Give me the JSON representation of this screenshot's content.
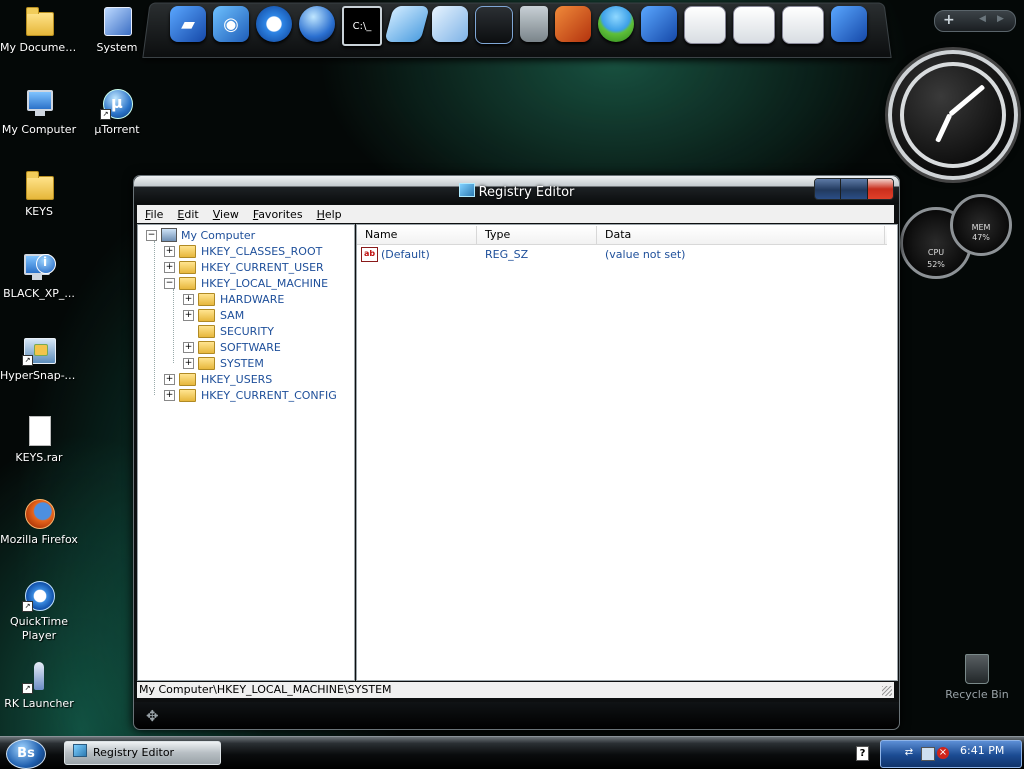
{
  "desktop": {
    "icons": [
      {
        "label": "My Documents"
      },
      {
        "label": "System"
      },
      {
        "label": "My Computer"
      },
      {
        "label": "µTorrent"
      },
      {
        "label": "KEYS"
      },
      {
        "label": "BLACK_XP_..."
      },
      {
        "label": "HyperSnap-v..."
      },
      {
        "label": "KEYS.rar"
      },
      {
        "label": "Mozilla Firefox"
      },
      {
        "label": "QuickTime Player"
      },
      {
        "label": "RK Launcher"
      }
    ],
    "recycle_bin": "Recycle Bin"
  },
  "dock": {
    "items": [
      "folder-icon",
      "media-player-icon",
      "quicktime-icon",
      "globe-icon",
      "command-prompt-icon",
      "notepad-icon",
      "network-icon",
      "drive-icon",
      "trash-icon",
      "firefox-icon",
      "balloon-icon",
      "folder-icon",
      "windows-icon",
      "windows-icon",
      "windows-icon",
      "folder-icon"
    ],
    "top_button": "+"
  },
  "gadgets": {
    "cpu_label": "CPU",
    "cpu_value": "52%",
    "mem_label": "MEM",
    "mem_value": "47%"
  },
  "window": {
    "title": "Registry Editor",
    "menu": [
      {
        "u": "F",
        "rest": "ile"
      },
      {
        "u": "E",
        "rest": "dit"
      },
      {
        "u": "V",
        "rest": "iew"
      },
      {
        "u": "F",
        "rest": "avorites"
      },
      {
        "u": "H",
        "rest": "elp"
      }
    ],
    "tree": {
      "root": "My Computer",
      "hives": [
        "HKEY_CLASSES_ROOT",
        "HKEY_CURRENT_USER",
        "HKEY_LOCAL_MACHINE"
      ],
      "children": [
        "HARDWARE",
        "SAM",
        "SECURITY",
        "SOFTWARE",
        "SYSTEM"
      ],
      "more_hives": [
        "HKEY_USERS",
        "HKEY_CURRENT_CONFIG"
      ]
    },
    "columns": [
      "Name",
      "Type",
      "Data"
    ],
    "rows": [
      {
        "name": "(Default)",
        "type": "REG_SZ",
        "data": "(value not set)"
      }
    ],
    "status": "My Computer\\HKEY_LOCAL_MACHINE\\SYSTEM"
  },
  "taskbar": {
    "start_label": "Bs",
    "task": "Registry Editor",
    "time": "6:41 PM"
  }
}
